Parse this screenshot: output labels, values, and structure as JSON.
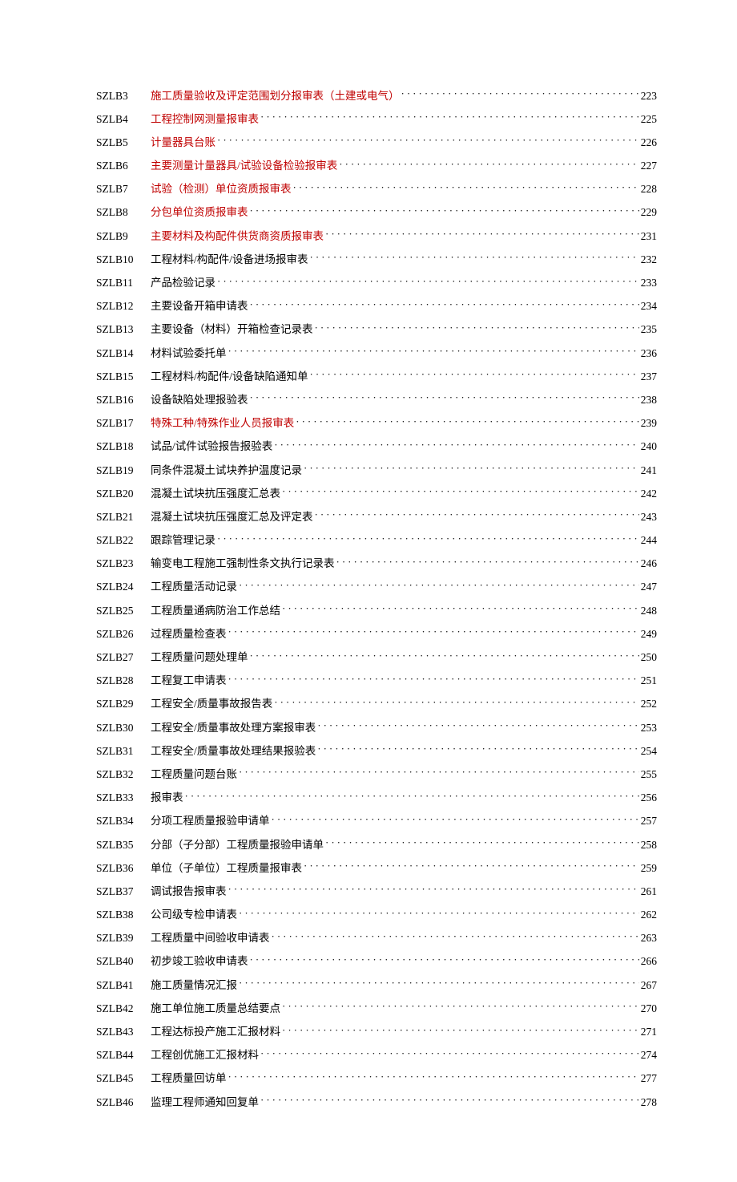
{
  "toc": {
    "entries": [
      {
        "code": "SZLB3",
        "title": "施工质量验收及评定范围划分报审表（土建或电气）",
        "page": "223",
        "highlight": true
      },
      {
        "code": "SZLB4",
        "title": "工程控制网测量报审表",
        "page": "225",
        "highlight": true
      },
      {
        "code": "SZLB5",
        "title": "计量器具台账",
        "page": "226",
        "highlight": true
      },
      {
        "code": "SZLB6",
        "title": "主要测量计量器具/试验设备检验报审表",
        "page": "227",
        "highlight": true
      },
      {
        "code": "SZLB7",
        "title": "试验（检测）单位资质报审表",
        "page": "228",
        "highlight": true
      },
      {
        "code": "SZLB8",
        "title": "分包单位资质报审表",
        "page": "229",
        "highlight": true
      },
      {
        "code": "SZLB9",
        "title": "主要材料及构配件供货商资质报审表",
        "page": "231",
        "highlight": true
      },
      {
        "code": "SZLB10",
        "title": "工程材料/构配件/设备进场报审表",
        "page": "232",
        "highlight": false
      },
      {
        "code": "SZLB11",
        "title": "产品检验记录",
        "page": "233",
        "highlight": false
      },
      {
        "code": "SZLB12",
        "title": "主要设备开箱申请表",
        "page": "234",
        "highlight": false
      },
      {
        "code": "SZLB13",
        "title": "主要设备（材料）开箱检查记录表",
        "page": "235",
        "highlight": false
      },
      {
        "code": "SZLB14",
        "title": "材料试验委托单",
        "page": "236",
        "highlight": false
      },
      {
        "code": "SZLB15",
        "title": "工程材料/构配件/设备缺陷通知单",
        "page": "237",
        "highlight": false
      },
      {
        "code": "SZLB16",
        "title": "设备缺陷处理报验表",
        "page": "238",
        "highlight": false
      },
      {
        "code": "SZLB17",
        "title": "特殊工种/特殊作业人员报审表",
        "page": "239",
        "highlight": true
      },
      {
        "code": "SZLB18",
        "title": "试品/试件试验报告报验表",
        "page": "240",
        "highlight": false
      },
      {
        "code": "SZLB19",
        "title": "同条件混凝土试块养护温度记录",
        "page": "241",
        "highlight": false
      },
      {
        "code": "SZLB20",
        "title": "混凝土试块抗压强度汇总表",
        "page": "242",
        "highlight": false
      },
      {
        "code": "SZLB21",
        "title": "混凝土试块抗压强度汇总及评定表",
        "page": "243",
        "highlight": false
      },
      {
        "code": "SZLB22",
        "title": "跟踪管理记录",
        "page": "244",
        "highlight": false
      },
      {
        "code": "SZLB23",
        "title": "输变电工程施工强制性条文执行记录表",
        "page": "246",
        "highlight": false
      },
      {
        "code": "SZLB24",
        "title": "工程质量活动记录",
        "page": "247",
        "highlight": false
      },
      {
        "code": "SZLB25",
        "title": "工程质量通病防治工作总结",
        "page": "248",
        "highlight": false
      },
      {
        "code": "SZLB26",
        "title": "过程质量检查表",
        "page": "249",
        "highlight": false
      },
      {
        "code": "SZLB27",
        "title": "工程质量问题处理单",
        "page": "250",
        "highlight": false
      },
      {
        "code": "SZLB28",
        "title": "工程复工申请表",
        "page": "251",
        "highlight": false
      },
      {
        "code": "SZLB29",
        "title": "工程安全/质量事故报告表",
        "page": "252",
        "highlight": false
      },
      {
        "code": "SZLB30",
        "title": "工程安全/质量事故处理方案报审表",
        "page": "253",
        "highlight": false
      },
      {
        "code": "SZLB31",
        "title": "工程安全/质量事故处理结果报验表",
        "page": "254",
        "highlight": false
      },
      {
        "code": "SZLB32",
        "title": "工程质量问题台账",
        "page": "255",
        "highlight": false
      },
      {
        "code": "SZLB33",
        "title": "报审表",
        "page": "256",
        "highlight": false
      },
      {
        "code": "SZLB34",
        "title": "分项工程质量报验申请单",
        "page": "257",
        "highlight": false
      },
      {
        "code": "SZLB35",
        "title": "分部（子分部）工程质量报验申请单",
        "page": "258",
        "highlight": false
      },
      {
        "code": "SZLB36",
        "title": "单位（子单位）工程质量报审表",
        "page": "259",
        "highlight": false
      },
      {
        "code": "SZLB37",
        "title": "调试报告报审表",
        "page": "261",
        "highlight": false
      },
      {
        "code": "SZLB38",
        "title": "公司级专检申请表",
        "page": "262",
        "highlight": false
      },
      {
        "code": "SZLB39",
        "title": "工程质量中间验收申请表",
        "page": "263",
        "highlight": false
      },
      {
        "code": "SZLB40",
        "title": "初步竣工验收申请表",
        "page": "266",
        "highlight": false
      },
      {
        "code": "SZLB41",
        "title": "施工质量情况汇报",
        "page": "267",
        "highlight": false
      },
      {
        "code": "SZLB42",
        "title": "施工单位施工质量总结要点",
        "page": "270",
        "highlight": false
      },
      {
        "code": "SZLB43",
        "title": "工程达标投产施工汇报材料",
        "page": "271",
        "highlight": false
      },
      {
        "code": "SZLB44",
        "title": "工程创优施工汇报材料",
        "page": "274",
        "highlight": false
      },
      {
        "code": "SZLB45",
        "title": "工程质量回访单",
        "page": "277",
        "highlight": false
      },
      {
        "code": "SZLB46",
        "title": "监理工程师通知回复单",
        "page": "278",
        "highlight": false
      }
    ]
  }
}
